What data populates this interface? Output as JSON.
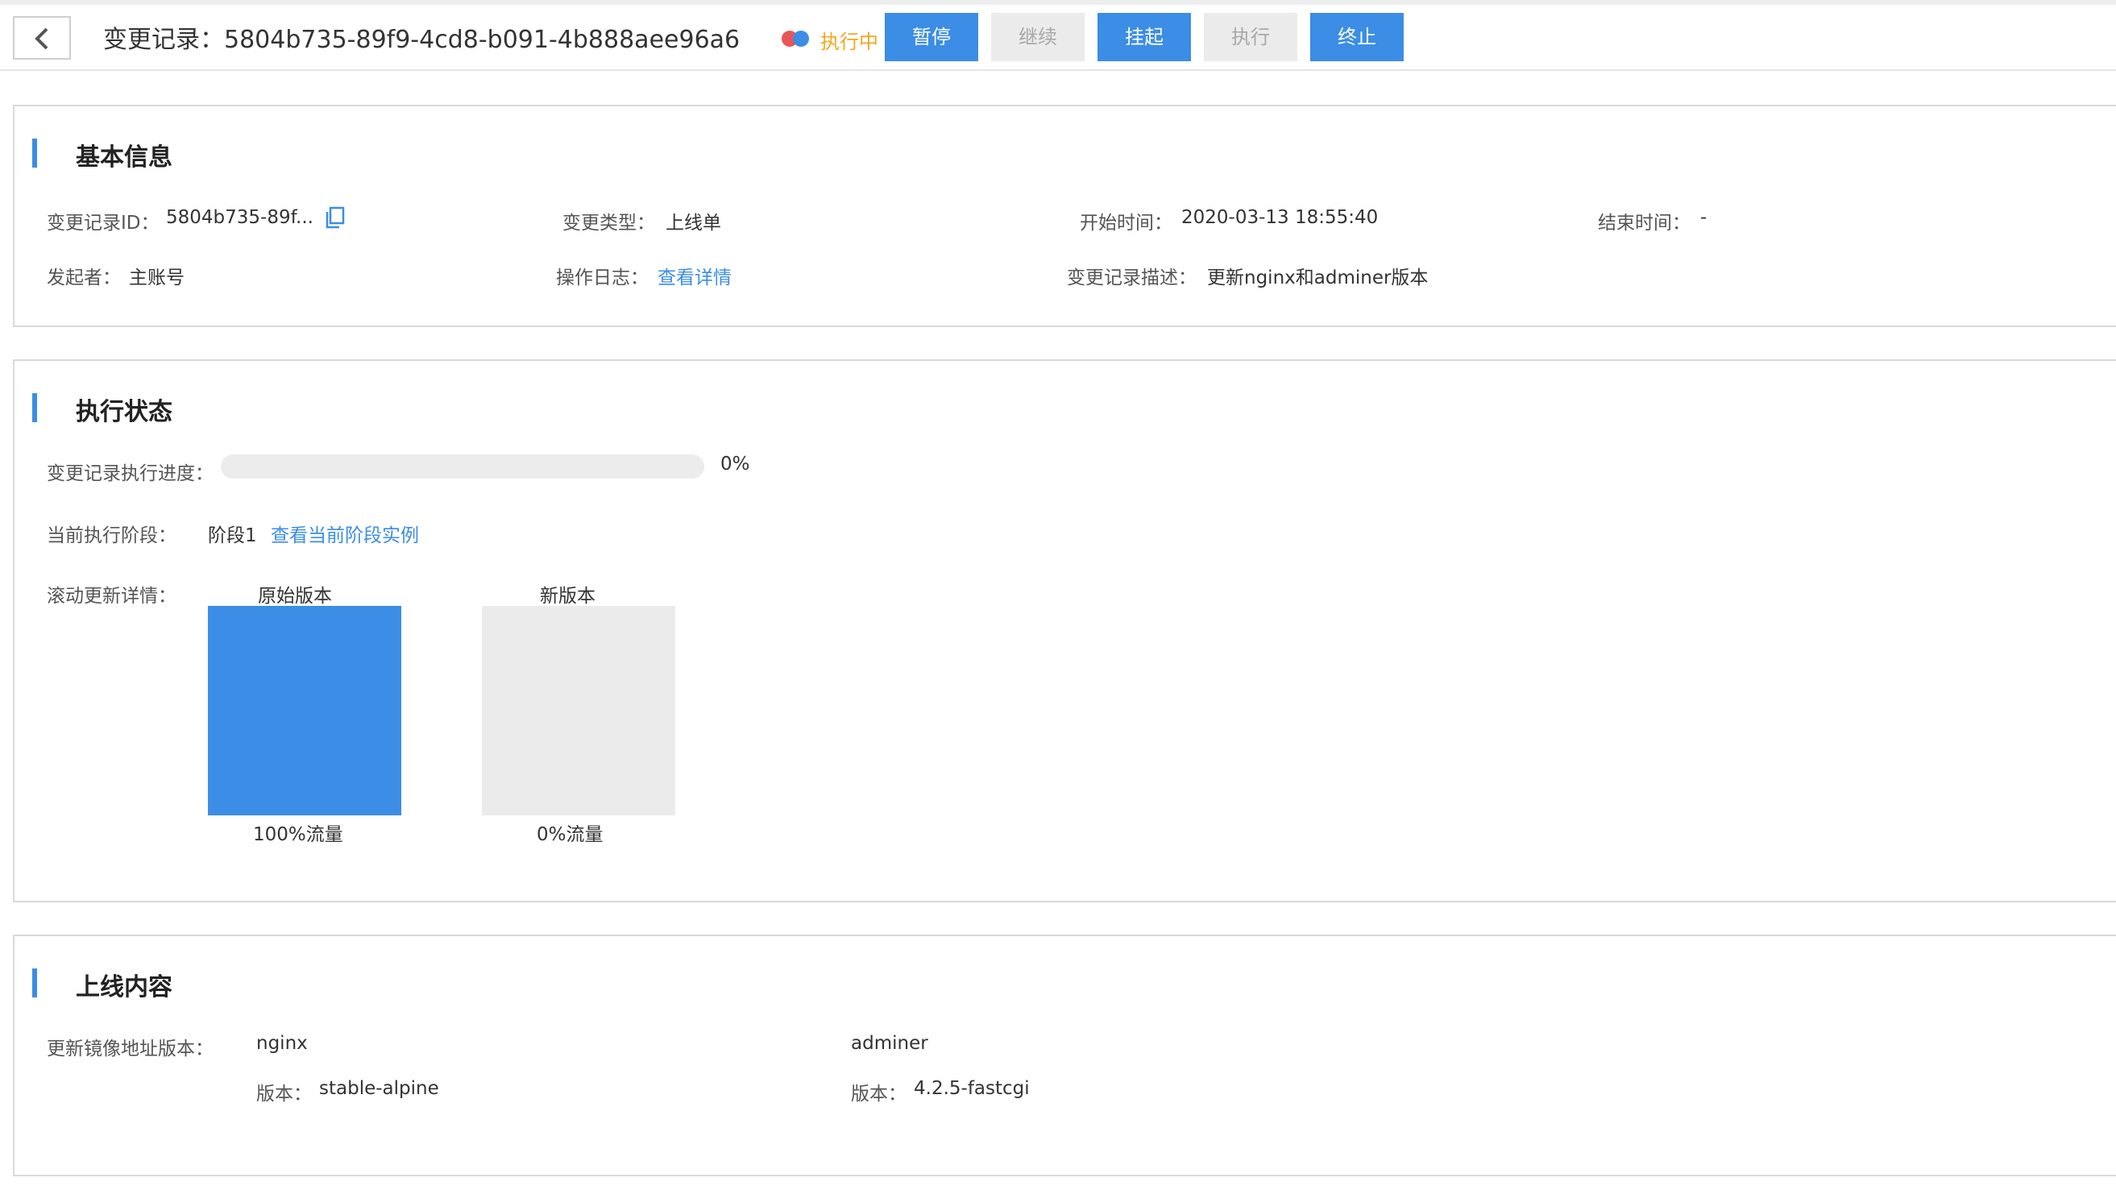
{
  "header": {
    "title": "变更记录：5804b735-89f9-4cd8-b091-4b888aee96a6",
    "status": "执行中",
    "buttons": {
      "pause": "暂停",
      "resume": "继续",
      "suspend": "挂起",
      "execute": "执行",
      "terminate": "终止"
    }
  },
  "basic_info": {
    "title": "基本信息",
    "record_id_label": "变更记录ID：",
    "record_id_value": "5804b735-89f...",
    "change_type_label": "变更类型：",
    "change_type_value": "上线单",
    "start_time_label": "开始时间：",
    "start_time_value": "2020-03-13 18:55:40",
    "end_time_label": "结束时间：",
    "end_time_value": "-",
    "initiator_label": "发起者：",
    "initiator_value": "主账号",
    "op_log_label": "操作日志：",
    "op_log_link": "查看详情",
    "desc_label": "变更记录描述：",
    "desc_value": "更新nginx和adminer版本"
  },
  "exec_status": {
    "title": "执行状态",
    "progress_label": "变更记录执行进度：",
    "progress_percent": 0,
    "progress_text": "0%",
    "stage_label": "当前执行阶段：",
    "stage_value": "阶段1",
    "stage_link": "查看当前阶段实例",
    "rolling_label": "滚动更新详情：",
    "orig_version_label": "原始版本",
    "new_version_label": "新版本",
    "orig_traffic_percent": 100,
    "orig_traffic": "100%流量",
    "new_traffic_percent": 0,
    "new_traffic": "0%流量"
  },
  "release_content": {
    "title": "上线内容",
    "image_label": "更新镜像地址版本：",
    "images": [
      {
        "name": "nginx",
        "version_label": "版本：",
        "version": "stable-alpine"
      },
      {
        "name": "adminer",
        "version_label": "版本：",
        "version": "4.2.5-fastcgi"
      }
    ]
  },
  "colors": {
    "accent": "#3b8de6",
    "status_orange": "#f5a623",
    "status_red": "#e85656",
    "disabled_bg": "#ebebeb"
  },
  "icons": {
    "back": "chevron-left-icon",
    "copy": "copy-icon"
  }
}
